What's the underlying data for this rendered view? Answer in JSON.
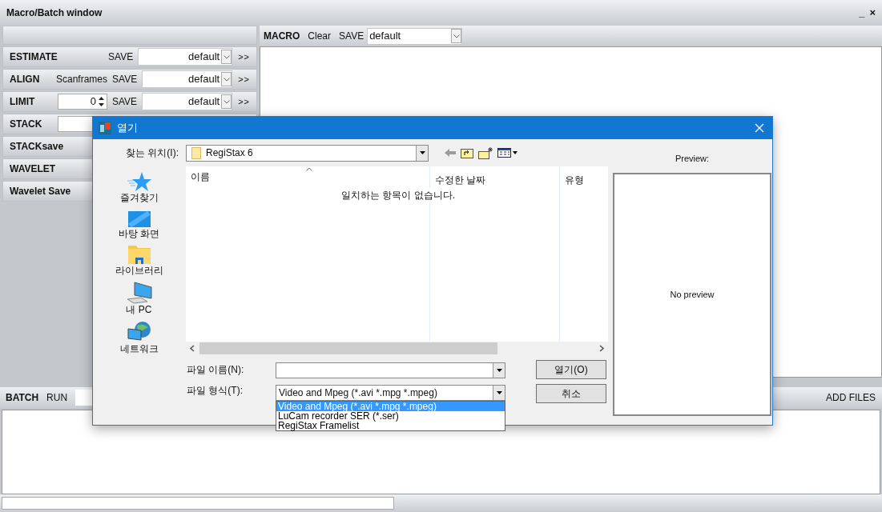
{
  "window": {
    "title": "Macro/Batch window",
    "controls": [
      "_",
      "×"
    ]
  },
  "left_panel": {
    "rows": [
      {
        "kind": "save",
        "label": "ESTIMATE",
        "save": "SAVE",
        "preset": "default",
        "more": ">>"
      },
      {
        "kind": "save",
        "label": "ALIGN",
        "note": "Scanframes",
        "save": "SAVE",
        "preset": "default",
        "more": ">>"
      },
      {
        "kind": "spin_save",
        "label": "LIMIT",
        "spin": "0",
        "save": "SAVE",
        "preset": "default",
        "more": ">>"
      },
      {
        "kind": "spin",
        "label": "STACK"
      },
      {
        "kind": "plain",
        "label": "STACKsave"
      },
      {
        "kind": "plain",
        "label": "WAVELET"
      },
      {
        "kind": "plain",
        "label": "Wavelet Save"
      }
    ]
  },
  "macro": {
    "title": "MACRO",
    "actions": [
      "Clear",
      "SAVE"
    ],
    "preset": "default"
  },
  "batch": {
    "title": "BATCH",
    "run": "RUN",
    "add_files": "ADD FILES"
  },
  "dialog": {
    "title": "열기",
    "location_label": "찾는 위치(I):",
    "location": "RegiStax 6",
    "places": [
      {
        "kind": "star",
        "label": "즐겨찾기"
      },
      {
        "kind": "desktop",
        "label": "바탕 화면"
      },
      {
        "kind": "library",
        "label": "라이브러리"
      },
      {
        "kind": "pc",
        "label": "내 PC"
      },
      {
        "kind": "network",
        "label": "네트워크"
      }
    ],
    "columns": [
      "이름",
      "수정한 날짜",
      "유형"
    ],
    "empty_message": "일치하는 항목이 없습니다.",
    "preview_label": "Preview:",
    "preview_text": "No preview",
    "filename_label": "파일 이름(N):",
    "filetype_label": "파일 형식(T):",
    "filetype": "Video and Mpeg (*.avi *.mpg *.mpeg)",
    "filetype_options": [
      {
        "label": "Video and Mpeg (*.avi *.mpg *.mpeg)",
        "selected": true
      },
      {
        "label": "LuCam recorder SER (*.ser)",
        "selected": false
      },
      {
        "label": "RegiStax Framelist",
        "selected": false
      }
    ],
    "buttons": [
      "열기(O)",
      "취소"
    ]
  }
}
